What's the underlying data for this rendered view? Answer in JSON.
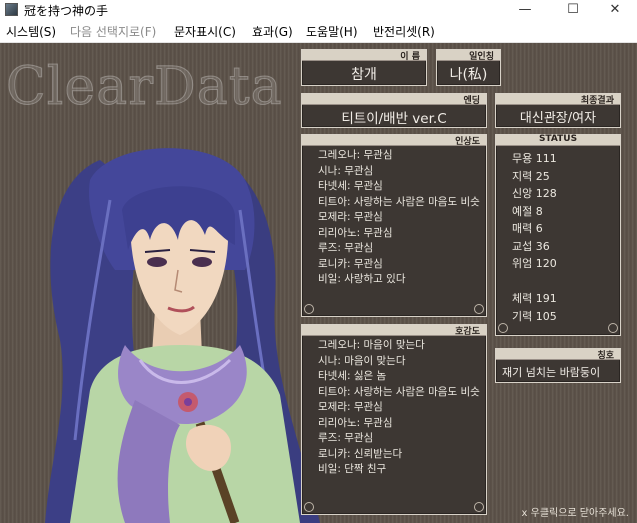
{
  "window": {
    "title": "冠を持つ神の手",
    "minimize": "—",
    "maximize": "☐",
    "close": "✕"
  },
  "menu": [
    {
      "label": "시스템(S)",
      "enabled": true
    },
    {
      "label": "다음 선택지로(F)",
      "enabled": false
    },
    {
      "label": "문자표시(C)",
      "enabled": true
    },
    {
      "label": "효과(G)",
      "enabled": true
    },
    {
      "label": "도움말(H)",
      "enabled": true
    },
    {
      "label": "반전리셋(R)",
      "enabled": true
    }
  ],
  "game": {
    "logo_text": "ClearData",
    "name_panel": {
      "title": "이 름",
      "value": "참개"
    },
    "pronoun_panel": {
      "title": "일인칭",
      "value": "나(私)"
    },
    "ending_panel": {
      "title": "엔딩",
      "value": "티트이/배반  ver.C"
    },
    "final_panel": {
      "title": "최종결과",
      "value": "대신관장/여자"
    },
    "impression_panel": {
      "title": "인상도",
      "lines": [
        "그레오나: 무관심",
        "시나: 무관심",
        "타넷세: 무관심",
        "티트아: 사랑하는 사람은 마음도 비슷",
        "모제라: 무관심",
        "리리아노: 무관심",
        "루즈: 무관심",
        "로니카: 무관심",
        "비일: 사랑하고 있다"
      ]
    },
    "status_panel": {
      "title": "STATUS",
      "stats": [
        {
          "label": "무용",
          "value": "111"
        },
        {
          "label": "지력",
          "value": "25"
        },
        {
          "label": "신앙",
          "value": "128"
        },
        {
          "label": "예절",
          "value": "8"
        },
        {
          "label": "매력",
          "value": "6"
        },
        {
          "label": "교섭",
          "value": "36"
        },
        {
          "label": "위엄",
          "value": "120"
        }
      ],
      "stats2": [
        {
          "label": "체력",
          "value": "191"
        },
        {
          "label": "기력",
          "value": "105"
        }
      ]
    },
    "favor_panel": {
      "title": "호감도",
      "lines": [
        "그레오나: 마음이 맞는다",
        "시나: 마음이 맞는다",
        "타넷세: 싫은 놈",
        "티트아: 사랑하는 사람은 마음도 비슷",
        "모제라: 무관심",
        "리리아노: 무관심",
        "루즈: 무관심",
        "로니카: 신뢰받는다",
        "비일: 단짝 친구"
      ]
    },
    "nickname_panel": {
      "title": "칭호",
      "value": "재기 넘치는 바람둥이"
    },
    "close_hint": "x 우클릭으로 닫아주세요."
  }
}
